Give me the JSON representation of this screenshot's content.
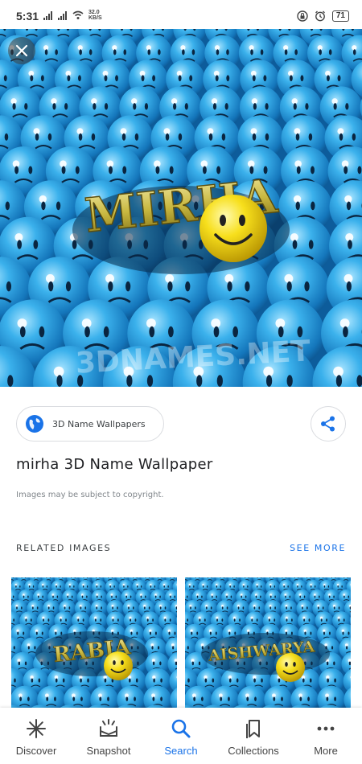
{
  "status_bar": {
    "time": "5:31",
    "network_speed_value": "32.0",
    "network_speed_unit": "KB/S",
    "battery": "71"
  },
  "hero": {
    "name_text": "MIRHA",
    "watermark": "3DNAMES.NET"
  },
  "source": {
    "label": "3D Name Wallpapers"
  },
  "image_title": "mirha 3D Name Wallpaper",
  "copyright_notice": "Images may be subject to copyright.",
  "related": {
    "header": "RELATED IMAGES",
    "see_more": "SEE MORE",
    "items": [
      {
        "name_text": "RABIA"
      },
      {
        "name_text": "AISHWARYA"
      }
    ]
  },
  "bottom_nav": {
    "items": [
      {
        "label": "Discover",
        "icon": "asterisk-icon",
        "active": false
      },
      {
        "label": "Snapshot",
        "icon": "snapshot-icon",
        "active": false
      },
      {
        "label": "Search",
        "icon": "search-icon",
        "active": true
      },
      {
        "label": "Collections",
        "icon": "bookmarks-icon",
        "active": false
      },
      {
        "label": "More",
        "icon": "more-dots-icon",
        "active": false
      }
    ]
  },
  "colors": {
    "accent": "#1a73e8",
    "smiley_blue": "#2fa8e6",
    "smiley_yellow": "#f5d312",
    "name_gold": "#d9c84a"
  }
}
